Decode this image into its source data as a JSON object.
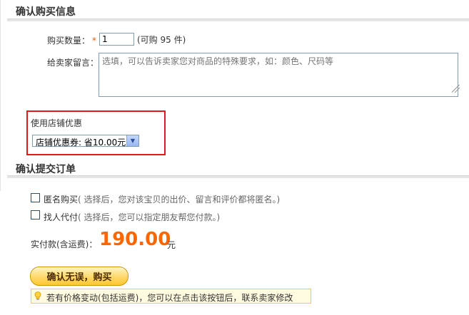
{
  "purchase_info": {
    "title": "确认购买信息",
    "quantity_label": "购买数量：",
    "required_mark": "*",
    "quantity_value": "1",
    "quantity_hint": "(可购 95 件)",
    "message_label": "给卖家留言：",
    "message_placeholder": "选填，可以告诉卖家您对商品的特殊要求，如：颜色、尺码等"
  },
  "shop_promo": {
    "title": "使用店铺优惠",
    "selected_option": "店铺优惠券: 省10.00元",
    "highlight_color": "#e0191f"
  },
  "submit_order": {
    "title": "确认提交订单",
    "anonymous_label": "匿名购买",
    "anonymous_hint": "( 选择后，您对该宝贝的出价、留言和评价都将匿名。)",
    "anonymous_checked": false,
    "proxy_label": "找人代付",
    "proxy_hint": "( 选择后，您可以指定朋友帮您付款。)",
    "proxy_checked": false,
    "pay_label": "实付款(含运费)：",
    "pay_amount": "190.00",
    "pay_unit": "元",
    "amount_color": "#ff6600",
    "confirm_button": "确认无误，购买",
    "tip_icon": "lightbulb-icon",
    "tip_text": "若有价格变动(包括运费)，您可以在点击该按钮后，联系卖家修改"
  }
}
